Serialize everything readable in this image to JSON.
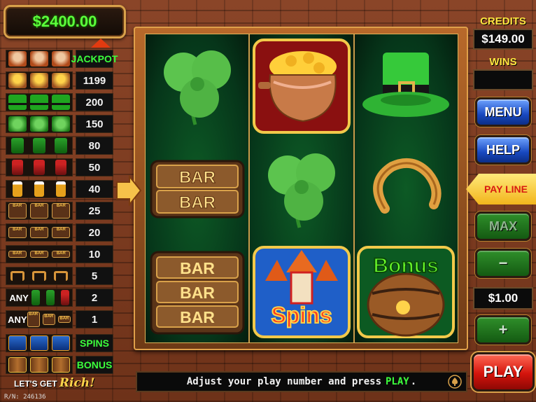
{
  "balance": "$2400.00",
  "paytable": {
    "jackpot_label": "JACKPOT",
    "any_label": "ANY",
    "rows": [
      {
        "icon": "leprechaun-lady-icon",
        "value": "JACKPOT"
      },
      {
        "icon": "pot-of-gold-icon",
        "value": "1199"
      },
      {
        "icon": "leprechaun-hat-icon",
        "value": "200"
      },
      {
        "icon": "clover-icon",
        "value": "150"
      },
      {
        "icon": "green-boot-icon",
        "value": "80"
      },
      {
        "icon": "red-beer-icon",
        "value": "50"
      },
      {
        "icon": "beer-glass-icon",
        "value": "40"
      },
      {
        "icon": "triple-bar-icon",
        "value": "25"
      },
      {
        "icon": "double-bar-icon",
        "value": "20"
      },
      {
        "icon": "single-bar-icon",
        "value": "10"
      },
      {
        "icon": "horseshoe-icon",
        "value": "5"
      },
      {
        "icon": "any-boot-beer-icon",
        "value": "2"
      },
      {
        "icon": "any-bar-icon",
        "value": "1"
      },
      {
        "icon": "spins-icon",
        "value": "SPINS"
      },
      {
        "icon": "bonus-barrel-icon",
        "value": "BONUS"
      }
    ]
  },
  "logo": {
    "prefix": "LET'S GET",
    "word": "Rich!"
  },
  "serial": "R/N: 246136",
  "reels": {
    "bar": "BAR",
    "spins": "Spins",
    "bonus": "Bonus"
  },
  "right_panel": {
    "credits_label": "CREDITS",
    "credits_value": "$149.00",
    "wins_label": "WINS",
    "wins_value": "",
    "menu": "MENU",
    "help": "HELP",
    "payline": "PAY LINE",
    "max": "MAX",
    "minus": "−",
    "bet": "$1.00",
    "plus": "+",
    "play": "PLAY"
  },
  "message": {
    "before": "Adjust your play number and press",
    "highlight": "PLAY",
    "after": "."
  },
  "colors": {
    "balance_text": "#5cff3c",
    "label_yellow": "#ffe640",
    "payline_red": "#d81a10",
    "play_red": "#d4140c",
    "menu_blue": "#1848c0"
  }
}
